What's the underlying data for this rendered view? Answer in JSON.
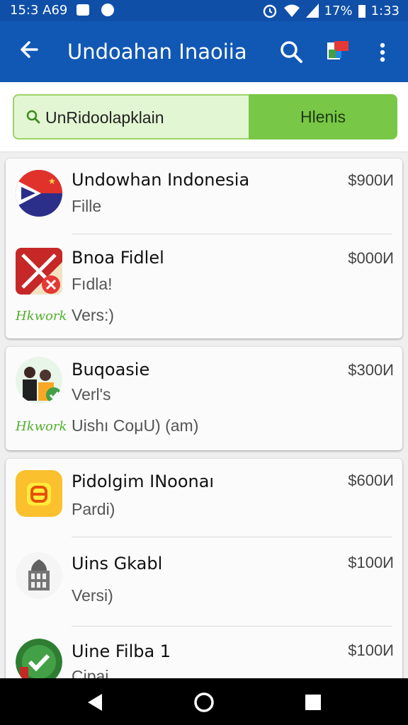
{
  "status_bar": {
    "time_left": "15:3 A69",
    "battery": "17%",
    "time_right": "1:33"
  },
  "app_bar": {
    "title": "Undoahan Inaoiia"
  },
  "search": {
    "value": "UnRidoolapklain",
    "button_label": "Hlenis"
  },
  "items": [
    {
      "name": "Undowhan Indonesia",
      "sub": "Fille",
      "sub2": "",
      "tag": "",
      "price": "$900И",
      "icon": "flag-icon"
    },
    {
      "name": "Bnoa Fidlel",
      "sub": "Fıdla!",
      "sub2": "Vers:)",
      "tag": "Hkwork",
      "price": "$000И",
      "icon": "map-icon"
    },
    {
      "name": "Buqoasie",
      "sub": "Verl's",
      "sub2": "Uishı CoμU) (am)",
      "tag": "Hkwork",
      "price": "$300И",
      "icon": "people-icon"
    },
    {
      "name": "Pidolgim INoonaı",
      "sub": "Pardi)",
      "sub2": "",
      "tag": "",
      "price": "$600И",
      "icon": "orange-app-icon"
    },
    {
      "name": "Uins Gkabl",
      "sub": "Versi)",
      "sub2": "",
      "tag": "",
      "price": "$100И",
      "icon": "building-icon"
    },
    {
      "name": "Uine Filba 1",
      "sub": "Cipai",
      "sub2": "",
      "tag": "",
      "price": "$100И",
      "icon": "green-check-icon"
    }
  ],
  "colors": {
    "app_bar": "#1158b5",
    "status_bar": "#0f4fa8",
    "accent_green": "#79c746"
  }
}
